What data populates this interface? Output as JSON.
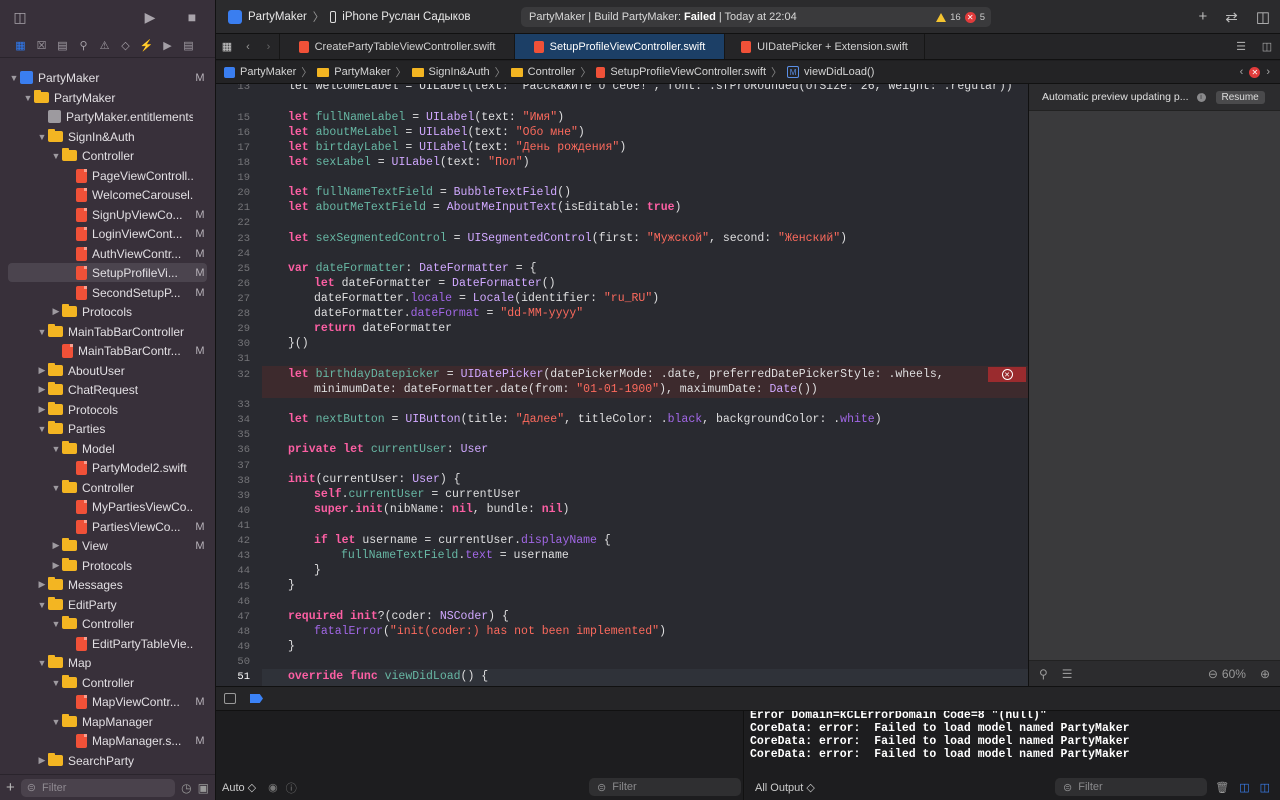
{
  "toolbar": {
    "scheme_project": "PartyMaker",
    "scheme_device": "iPhone Руслан Садыков",
    "status_prefix": "PartyMaker | Build PartyMaker:",
    "status_result": "Failed",
    "status_suffix": "| Today at 22:04",
    "warning_count": "16",
    "error_count": "5"
  },
  "tabs": [
    {
      "label": "CreatePartyTableViewController.swift"
    },
    {
      "label": "SetupProfileViewController.swift"
    },
    {
      "label": "UIDatePicker + Extension.swift"
    }
  ],
  "jumpbar": [
    "PartyMaker",
    "PartyMaker",
    "SignIn&Auth",
    "Controller",
    "SetupProfileViewController.swift",
    "viewDidLoad()"
  ],
  "sidebar": {
    "filter_placeholder": "Filter",
    "items": [
      {
        "name": "PartyMaker",
        "mark": "M"
      },
      {
        "name": "PartyMaker",
        "mark": ""
      },
      {
        "name": "PartyMaker.entitlements",
        "mark": ""
      },
      {
        "name": "SignIn&Auth",
        "mark": ""
      },
      {
        "name": "Controller",
        "mark": ""
      },
      {
        "name": "PageViewControll...",
        "mark": ""
      },
      {
        "name": "WelcomeCarousel...",
        "mark": ""
      },
      {
        "name": "SignUpViewCo...",
        "mark": "M"
      },
      {
        "name": "LoginViewCont...",
        "mark": "M"
      },
      {
        "name": "AuthViewContr...",
        "mark": "M"
      },
      {
        "name": "SetupProfileVi...",
        "mark": "M"
      },
      {
        "name": "SecondSetupP...",
        "mark": "M"
      },
      {
        "name": "Protocols",
        "mark": ""
      },
      {
        "name": "MainTabBarController",
        "mark": ""
      },
      {
        "name": "MainTabBarContr...",
        "mark": "M"
      },
      {
        "name": "AboutUser",
        "mark": ""
      },
      {
        "name": "ChatRequest",
        "mark": ""
      },
      {
        "name": "Protocols",
        "mark": ""
      },
      {
        "name": "Parties",
        "mark": ""
      },
      {
        "name": "Model",
        "mark": ""
      },
      {
        "name": "PartyModel2.swift",
        "mark": ""
      },
      {
        "name": "Controller",
        "mark": ""
      },
      {
        "name": "MyPartiesViewCo...",
        "mark": ""
      },
      {
        "name": "PartiesViewCo...",
        "mark": "M"
      },
      {
        "name": "View",
        "mark": "M"
      },
      {
        "name": "Protocols",
        "mark": ""
      },
      {
        "name": "Messages",
        "mark": ""
      },
      {
        "name": "EditParty",
        "mark": ""
      },
      {
        "name": "Controller",
        "mark": ""
      },
      {
        "name": "EditPartyTableVie...",
        "mark": ""
      },
      {
        "name": "Map",
        "mark": ""
      },
      {
        "name": "Controller",
        "mark": ""
      },
      {
        "name": "MapViewContr...",
        "mark": "M"
      },
      {
        "name": "MapManager",
        "mark": ""
      },
      {
        "name": "MapManager.s...",
        "mark": "M"
      },
      {
        "name": "SearchParty",
        "mark": ""
      }
    ]
  },
  "code": {
    "line_numbers": [
      "13",
      "15",
      "16",
      "17",
      "18",
      "19",
      "20",
      "21",
      "22",
      "23",
      "24",
      "25",
      "26",
      "27",
      "28",
      "29",
      "30",
      "31",
      "32",
      "",
      "33",
      "34",
      "35",
      "36",
      "37",
      "38",
      "39",
      "40",
      "41",
      "42",
      "43",
      "44",
      "45",
      "46",
      "47",
      "48",
      "49",
      "50",
      "51"
    ],
    "l13": "let welcomeLabel = UILabel(text: \"Расскажите о себе!\", font: .sfProRounded(ofSize: 26, weight: .regular))",
    "l15a": "let ",
    "l15b": "fullNameLabel",
    "l15c": " = ",
    "l15d": "UILabel",
    "l15e": "(text: ",
    "l15f": "\"Имя\"",
    "l15g": ")",
    "l16b": "aboutMeLabel",
    "l16f": "\"Обо мне\"",
    "l17b": "birtdayLabel",
    "l17f": "\"День рождения\"",
    "l18b": "sexLabel",
    "l18f": "\"Пол\"",
    "l20b": "fullNameTextField",
    "l20d": "BubbleTextField",
    "l20e": "()",
    "l21b": "aboutMeTextField",
    "l21d": "AboutMeInputText",
    "l21e": "(isEditable: ",
    "l21f": "true",
    "l21g": ")",
    "l23b": "sexSegmentedControl",
    "l23d": "UISegmentedControl",
    "l23e": "(first: ",
    "l23f": "\"Мужской\"",
    "l23g": ", second: ",
    "l23h": "\"Женский\"",
    "l23i": ")",
    "l25a": "var ",
    "l25b": "dateFormatter",
    "l25c": ": ",
    "l25d": "DateFormatter",
    "l25e": " = {",
    "l26": "dateFormatter",
    "l26d": "DateFormatter",
    "l26e": "()",
    "l27a": "dateFormatter.",
    "l27b": "locale",
    "l27c": " = ",
    "l27d": "Locale",
    "l27e": "(identifier: ",
    "l27f": "\"ru_RU\"",
    "l27g": ")",
    "l28a": "dateFormatter.",
    "l28b": "dateFormat",
    "l28c": " = ",
    "l28f": "\"dd-MM-yyyy\"",
    "l29a": "return ",
    "l29b": "dateFormatter",
    "l30": "}()",
    "l32a": "let ",
    "l32b": "birthdayDatepicker",
    "l32c": " = ",
    "l32d": "UIDatePicker",
    "l32e": "(datePickerMode: .date, preferredDatePickerStyle: .wheels,",
    "l32x1": "minimumDate: ",
    "l32x2": "dateFormatter",
    "l32x3": ".date(from: ",
    "l32x4": "\"01-01-1900\"",
    "l32x5": "), maximumDate: ",
    "l32x6": "Date",
    "l32x7": "())",
    "l34b": "nextButton",
    "l34d": "UIButton",
    "l34e": "(title: ",
    "l34f": "\"Далее\"",
    "l34g": ", titleColor: .",
    "l34h": "black",
    "l34i": ", backgroundColor: .",
    "l34j": "white",
    "l34k": ")",
    "l36a": "private let ",
    "l36b": "currentUser",
    "l36c": ": ",
    "l36d": "User",
    "l38a": "init",
    "l38b": "(currentUser: ",
    "l38c": "User",
    "l38d": ") {",
    "l39a": "self",
    "l39b": ".",
    "l39c": "currentUser",
    "l39d": " = currentUser",
    "l40a": "super",
    "l40b": ".",
    "l40c": "init",
    "l40d": "(nibName: ",
    "l40e": "nil",
    "l40f": ", bundle: ",
    "l40g": "nil",
    "l40h": ")",
    "l42a": "if let ",
    "l42b": "username = currentUser.",
    "l42c": "displayName",
    "l42d": " {",
    "l43a": "fullNameTextField",
    "l43b": ".",
    "l43c": "text",
    "l43d": " = username",
    "l44": "}",
    "l45": "}",
    "l47a": "required init",
    "l47b": "?(coder: ",
    "l47c": "NSCoder",
    "l47d": ") {",
    "l48a": "fatalError",
    "l48b": "(",
    "l48c": "\"init(coder:) has not been implemented\"",
    "l48d": ")",
    "l49": "}",
    "l51a": "override func ",
    "l51b": "viewDidLoad",
    "l51c": "() {"
  },
  "preview": {
    "message": "Automatic preview updating p...",
    "resume_label": "Resume",
    "zoom": "60%"
  },
  "debug": {
    "auto_label": "Auto ◇",
    "vars_filter": "Filter",
    "output_label": "All Output ◇",
    "console_filter": "Filter",
    "console_lines": [
      "Error Domain=kCLErrorDomain Code=8 \"(null)\"",
      "CoreData: error:  Failed to load model named PartyMaker",
      "CoreData: error:  Failed to load model named PartyMaker",
      "CoreData: error:  Failed to load model named PartyMaker"
    ]
  }
}
